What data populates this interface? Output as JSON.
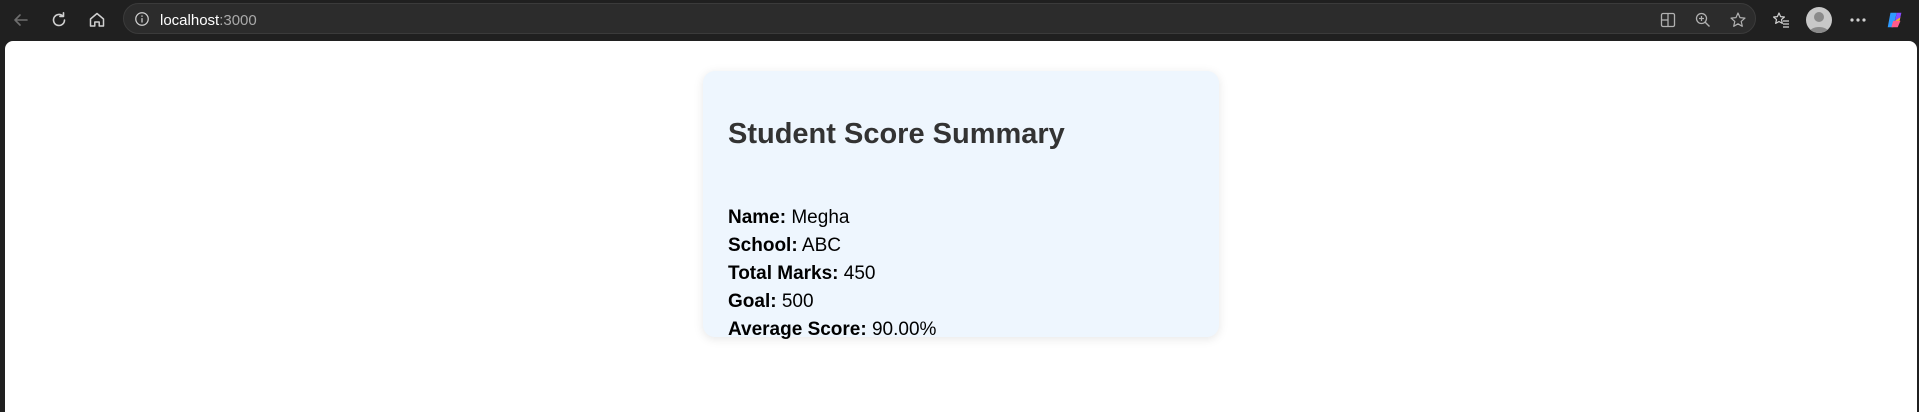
{
  "browser": {
    "url_host": "localhost",
    "url_port": ":3000",
    "icons": {
      "back": "back-arrow-icon",
      "refresh": "refresh-icon",
      "home": "home-icon",
      "info": "info-icon",
      "split": "split-screen-icon",
      "zoom": "zoom-icon",
      "favorite": "star-icon",
      "favorites": "favorites-icon",
      "profile": "profile-avatar",
      "menu": "more-icon",
      "copilot": "copilot-icon"
    }
  },
  "card": {
    "title": "Student Score Summary",
    "rows": [
      {
        "label": "Name:",
        "value": "Megha"
      },
      {
        "label": "School:",
        "value": "ABC"
      },
      {
        "label": "Total Marks:",
        "value": "450"
      },
      {
        "label": "Goal:",
        "value": "500"
      },
      {
        "label": "Average Score:",
        "value": "90.00%"
      }
    ]
  },
  "colors": {
    "chrome": "#202020",
    "card_bg": "#eef6fe",
    "title": "#333333"
  }
}
